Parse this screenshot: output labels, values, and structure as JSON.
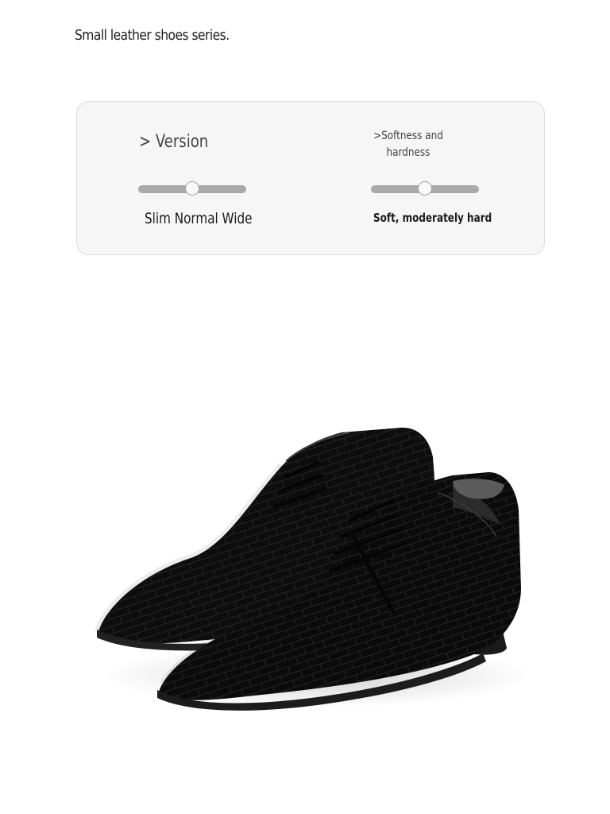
{
  "page": {
    "title": "Small leather shoes series."
  },
  "specs": {
    "version": {
      "heading": "> Version",
      "value_label": "Slim Normal Wide",
      "level": 0.5
    },
    "softness": {
      "heading_lines": [
        ">Softness and",
        "hardness"
      ],
      "value_label": "Soft, moderately hard",
      "level": 0.5
    }
  },
  "product_image": {
    "subject": "black crocodile-embossed leather lace-up dress shoes"
  },
  "colors": {
    "card_background": "#f6f6f6",
    "slider_track": "#a9a9a9",
    "leather": "#111111"
  }
}
